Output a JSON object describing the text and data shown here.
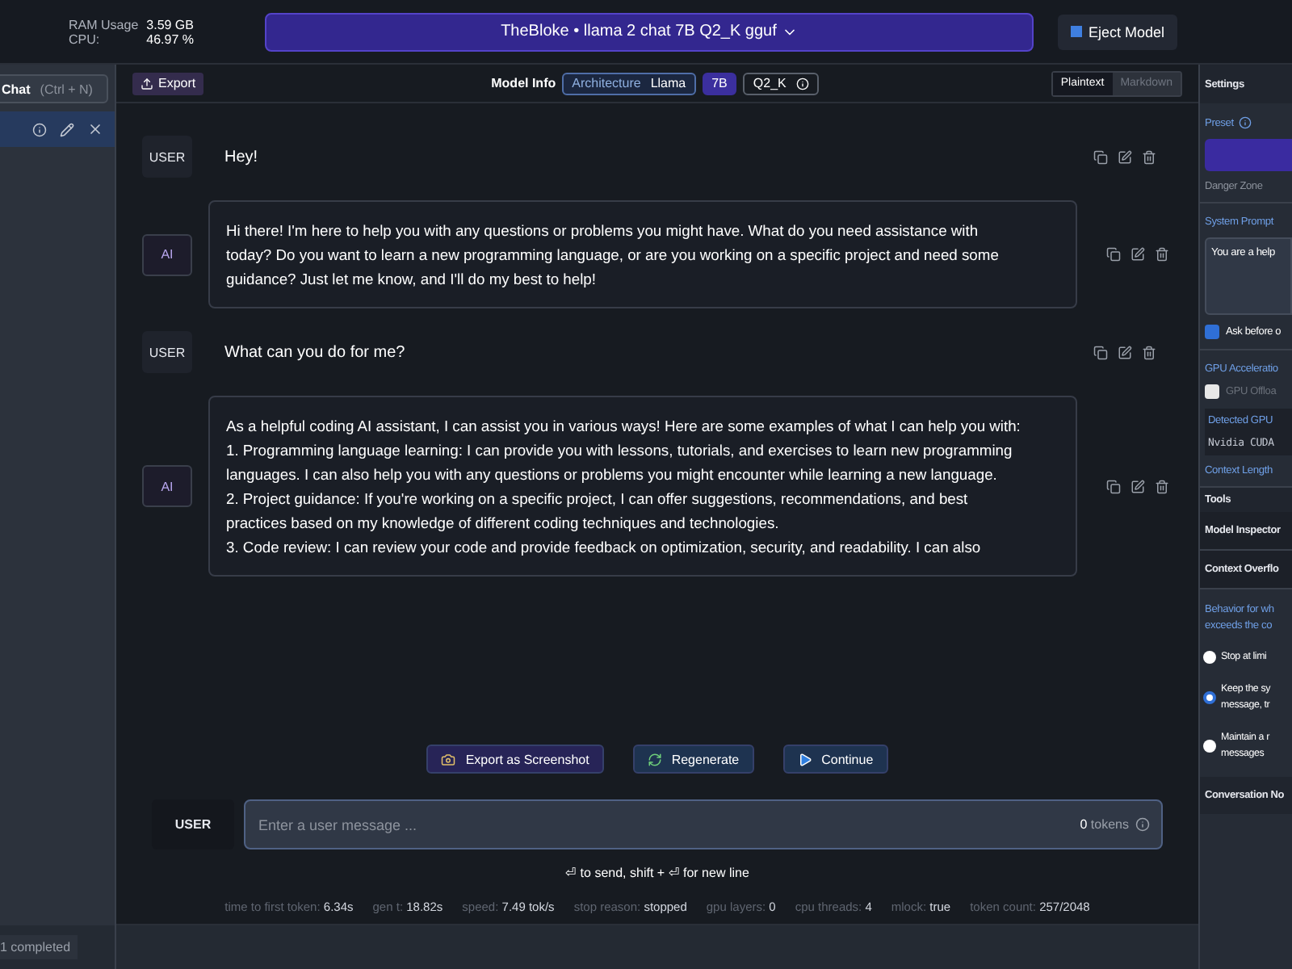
{
  "top_bar": {
    "ram_label": "RAM Usage",
    "ram_value": "3.59 GB",
    "cpu_label": "CPU:",
    "cpu_value": "46.97 %",
    "model_selector": "TheBloke • llama 2 chat 7B Q2_K gguf",
    "eject_button": "Eject Model"
  },
  "sidebar": {
    "new_chat_button": "Chat",
    "shortcut": "(Ctrl + N)",
    "chats": [
      {
        "selected": true
      }
    ],
    "status": "1 completed"
  },
  "toolbar": {
    "export_button": "Export",
    "model_info_label": "Model Info",
    "architecture_label": "Architecture",
    "architecture_value": "Llama",
    "size_tag": "7B",
    "quant_tag": "Q2_K",
    "view_modes": [
      {
        "label": "Plaintext",
        "selected": true
      },
      {
        "label": "Markdown",
        "selected": false
      }
    ]
  },
  "messages": [
    {
      "role": "USER",
      "kind": "plain",
      "text": "Hey!"
    },
    {
      "role": "AI",
      "kind": "bubble",
      "lines": [
        "Hi there! I'm here to help you with any questions or problems you might have. What do you need assistance with",
        "today? Do you want to learn a new programming language, or are you working on a specific project and need some",
        "guidance? Just let me know, and I'll do my best to help!"
      ]
    },
    {
      "role": "USER",
      "kind": "plain",
      "text": "What can you do for me?"
    },
    {
      "role": "AI",
      "kind": "bubble",
      "lines": [
        "As a helpful coding AI assistant, I can assist you in various ways! Here are some examples of what I can help you with:",
        "1. Programming language learning: I can provide you with lessons, tutorials, and exercises to learn new programming",
        "languages. I can also help you with any questions or problems you might encounter while learning a new language.",
        "2. Project guidance: If you're working on a specific project, I can offer suggestions, recommendations, and best",
        "practices based on my knowledge of different coding techniques and technologies.",
        "3. Code review: I can review your code and provide feedback on optimization, security, and readability. I can also"
      ]
    }
  ],
  "actions": [
    {
      "kind": "screenshot",
      "label": "Export as Screenshot"
    },
    {
      "kind": "regenerate",
      "label": "Regenerate"
    },
    {
      "kind": "continue",
      "label": "Continue"
    }
  ],
  "composer": {
    "role": "USER",
    "placeholder": "Enter a user message ...",
    "token_count": "0",
    "token_label": "tokens"
  },
  "hint": "⏎ to send, shift + ⏎ for new line",
  "stats": [
    {
      "label": "time to first token:",
      "value": "6.34s"
    },
    {
      "label": "gen t:",
      "value": "18.82s"
    },
    {
      "label": "speed:",
      "value": "7.49 tok/s"
    },
    {
      "label": "stop reason:",
      "value": "stopped"
    },
    {
      "label": "gpu layers:",
      "value": "0"
    },
    {
      "label": "cpu threads:",
      "value": "4"
    },
    {
      "label": "mlock:",
      "value": "true"
    },
    {
      "label": "token count:",
      "value": "257/2048"
    }
  ],
  "settings": {
    "title": "Settings",
    "preset_label": "Preset",
    "danger_zone": "Danger Zone",
    "system_prompt_label": "System Prompt",
    "system_prompt": "You are a help",
    "ask_before": {
      "label": "Ask before o",
      "checked": true
    },
    "gpu_label": "GPU Acceleratio",
    "gpu_offload": {
      "label": "GPU Offloa",
      "checked": false
    },
    "detected_gpu_label": "Detected GPU",
    "detected_gpu": "Nvidia CUDA",
    "context_length_label": "Context Length",
    "tools_label": "Tools",
    "tools": [
      "Model Inspector",
      "Context Overflo"
    ],
    "behavior_lines": [
      "Behavior for wh",
      "exceeds the co"
    ],
    "overflow_options": [
      {
        "lines": [
          "Stop at limi"
        ],
        "selected": false
      },
      {
        "lines": [
          "Keep the sy",
          "message, tr"
        ],
        "selected": true
      },
      {
        "lines": [
          "Maintain a r",
          "messages"
        ],
        "selected": false
      }
    ],
    "conversation_notes": "Conversation No"
  }
}
